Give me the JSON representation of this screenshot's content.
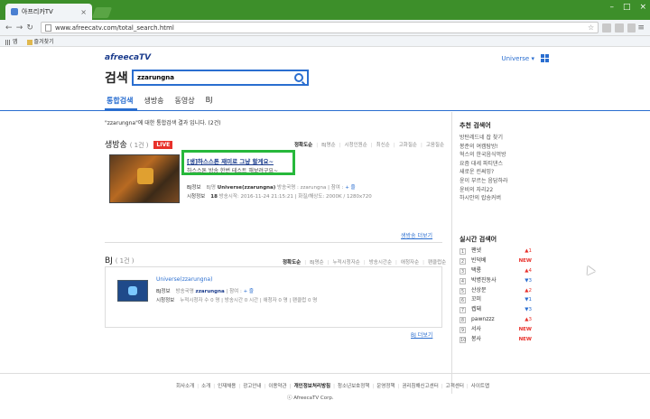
{
  "browser": {
    "tab_title": "아프리카TV",
    "url": "www.afreecatv.com/total_search.html",
    "bookmarks": [
      "앱",
      "즐겨찾기"
    ]
  },
  "header": {
    "logo": "afreecaTV",
    "universe": "Universe",
    "search_title": "검색",
    "search_value": "zzarungna"
  },
  "tabs": [
    "통합검색",
    "생방송",
    "동영상",
    "BJ"
  ],
  "summary": "\"zzarungna\"에 대한 통합검색 결과 입니다. (2건)",
  "live": {
    "title": "생방송",
    "count": "( 1건 )",
    "badge": "LIVE",
    "sort": [
      "정확도순",
      "BJ명순",
      "시청인원순",
      "최신순",
      "고화질순",
      "고음질순"
    ],
    "broadcast_title": "[생]하스스톤 재미로 그냥 할게요~",
    "broadcast_desc": "하스스톤 방송 한번 테스트 해보려구요~",
    "bj_label": "BJ정보",
    "bj_rank": "BJ명",
    "bj_name": "Universe(zzarungna)",
    "bj_extra": "방송국명 : zzarungna | 참여 :",
    "bj_link": "+ 즐",
    "view_label": "시청정보",
    "view_info": "방송시작: 2016-11-24 21:15:21 | 화질/해상도: 2000K / 1280x720",
    "view_count": "18",
    "more": "생방송 더보기"
  },
  "bj": {
    "title": "BJ",
    "count": "( 1건 )",
    "sort": [
      "정확도순",
      "BJ명순",
      "누적시청자순",
      "방송시간순",
      "애청자순",
      "팬클럽순"
    ],
    "name": "Universe(zzarungna)",
    "bj_label": "BJ정보",
    "bj_info_pre": "방송국명",
    "bj_info_name": "zzarungna",
    "bj_info_post": "| 참여 :",
    "bj_link": "+ 즐",
    "view_label": "시청정보",
    "view_info": "누적시청자 수 0 명 | 방송시간 0 시간 | 애청자 0 명 | 팬클럽 0 명",
    "more": "BJ 더보기"
  },
  "sidebar": {
    "rec_title": "추천 검색어",
    "rec_items": [
      "방탄레드네 잡 찾기",
      "봉준의 여캠탐방!",
      "혁스의 한국음식먹방",
      "요즘 대세 파티댄스",
      "새로운 린써밍?",
      "윤이 부르는 음담하라",
      "윤비의 자리22",
      "하시안의 랍숑커버"
    ],
    "rt_title": "실시간 검색어",
    "rt_items": [
      {
        "num": "1",
        "kw": "팬넷",
        "ch": "▲1",
        "cls": "up"
      },
      {
        "num": "2",
        "kw": "빈덕베",
        "ch": "NEW",
        "cls": "new"
      },
      {
        "num": "3",
        "kw": "택룡",
        "ch": "▲4",
        "cls": "up"
      },
      {
        "num": "4",
        "kw": "박병진동사",
        "ch": "▼3",
        "cls": "down"
      },
      {
        "num": "5",
        "kw": "산상문",
        "ch": "▲2",
        "cls": "up"
      },
      {
        "num": "6",
        "kw": "꼬미",
        "ch": "▼1",
        "cls": "down"
      },
      {
        "num": "7",
        "kw": "켑돼",
        "ch": "▼3",
        "cls": "down"
      },
      {
        "num": "8",
        "kw": "pawnzzz",
        "ch": "▲3",
        "cls": "up"
      },
      {
        "num": "9",
        "kw": "서사",
        "ch": "NEW",
        "cls": "new"
      },
      {
        "num": "10",
        "kw": "봉사",
        "ch": "NEW",
        "cls": "new"
      }
    ]
  },
  "footer": {
    "links": [
      "회사소개",
      "소개",
      "인재채용",
      "광고안내",
      "이용약관",
      "개인정보처리방침",
      "청소년보호정책",
      "운영정책",
      "권리침해신고센터",
      "고객센터",
      "사이트맵"
    ],
    "bold_link": "개인정보처리방침",
    "copyright": "ⓒ AfreecaTV Corp."
  }
}
